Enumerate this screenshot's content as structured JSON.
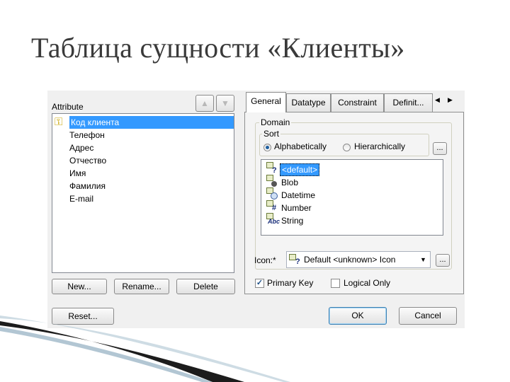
{
  "slide_title": "Таблица сущности «Клиенты»",
  "left": {
    "attribute_label": "Attribute",
    "attributes": [
      {
        "label": "Код клиента",
        "selected": true,
        "key": true
      },
      {
        "label": "Телефон"
      },
      {
        "label": "Адрес"
      },
      {
        "label": "Отчество"
      },
      {
        "label": "Имя"
      },
      {
        "label": "Фамилия"
      },
      {
        "label": "E-mail"
      }
    ],
    "buttons": {
      "new": "New...",
      "rename": "Rename...",
      "delete": "Delete",
      "reset": "Reset..."
    }
  },
  "right": {
    "tabs": [
      "General",
      "Datatype",
      "Constraint",
      "Definit..."
    ],
    "active_tab": "General",
    "domain_label": "Domain",
    "sort_label": "Sort",
    "sort_options": {
      "alphabetically": "Alphabetically",
      "hierarchically": "Hierarchically"
    },
    "sort_selected": "Alphabetically",
    "ellipsis": "...",
    "domains": [
      {
        "label": "<default>",
        "selected": true,
        "icon": "question-icon"
      },
      {
        "label": "Blob",
        "icon": "blob-icon"
      },
      {
        "label": "Datetime",
        "icon": "clock-icon"
      },
      {
        "label": "Number",
        "icon": "hash-icon"
      },
      {
        "label": "String",
        "icon": "abc-icon"
      }
    ],
    "icon_label": "Icon:*",
    "icon_value": "Default <unknown> Icon",
    "primary_key_label": "Primary Key",
    "primary_key_checked": true,
    "logical_only_label": "Logical Only",
    "logical_only_checked": false,
    "ok": "OK",
    "cancel": "Cancel"
  }
}
